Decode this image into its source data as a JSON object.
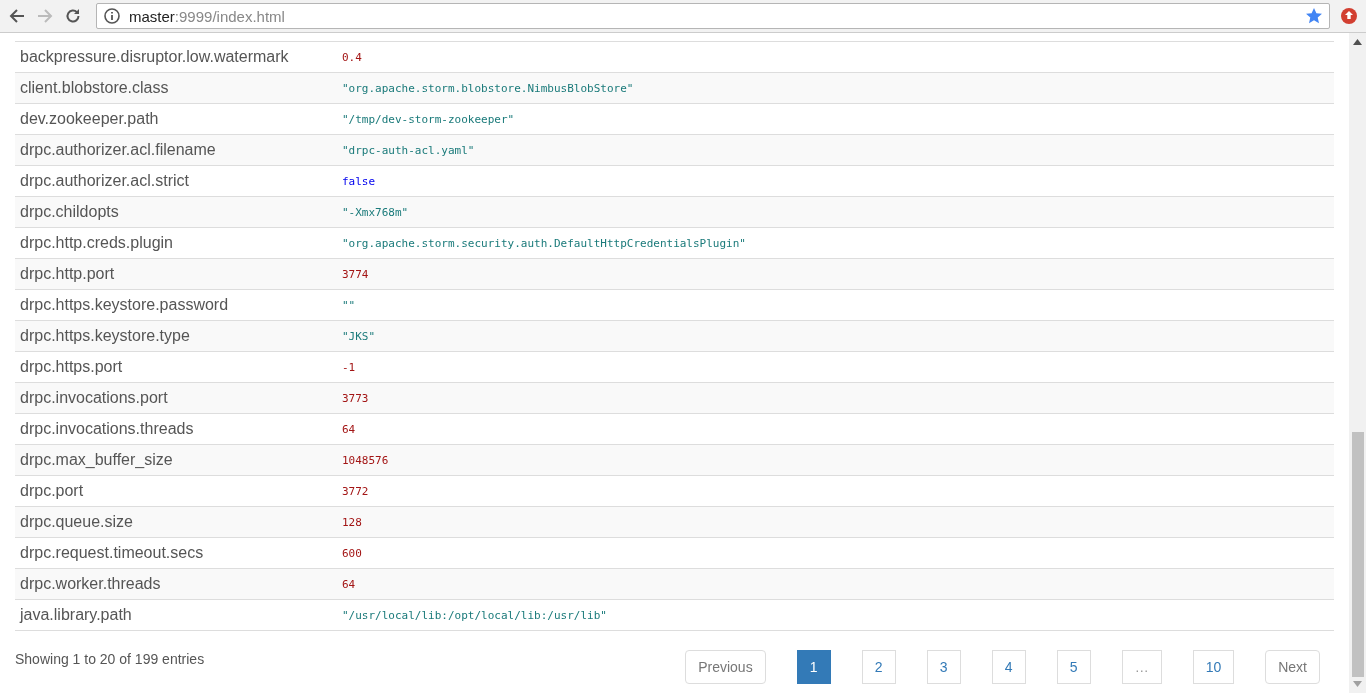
{
  "browser": {
    "url_host": "master",
    "url_path": ":9999/index.html"
  },
  "table": {
    "rows": [
      {
        "key": "backpressure.disruptor.low.watermark",
        "value": "0.4",
        "kind": "number"
      },
      {
        "key": "client.blobstore.class",
        "value": "\"org.apache.storm.blobstore.NimbusBlobStore\"",
        "kind": "string"
      },
      {
        "key": "dev.zookeeper.path",
        "value": "\"/tmp/dev-storm-zookeeper\"",
        "kind": "string"
      },
      {
        "key": "drpc.authorizer.acl.filename",
        "value": "\"drpc-auth-acl.yaml\"",
        "kind": "string"
      },
      {
        "key": "drpc.authorizer.acl.strict",
        "value": "false",
        "kind": "boolean"
      },
      {
        "key": "drpc.childopts",
        "value": "\"-Xmx768m\"",
        "kind": "string"
      },
      {
        "key": "drpc.http.creds.plugin",
        "value": "\"org.apache.storm.security.auth.DefaultHttpCredentialsPlugin\"",
        "kind": "string"
      },
      {
        "key": "drpc.http.port",
        "value": "3774",
        "kind": "number"
      },
      {
        "key": "drpc.https.keystore.password",
        "value": "\"\"",
        "kind": "string"
      },
      {
        "key": "drpc.https.keystore.type",
        "value": "\"JKS\"",
        "kind": "string"
      },
      {
        "key": "drpc.https.port",
        "value": "-1",
        "kind": "number"
      },
      {
        "key": "drpc.invocations.port",
        "value": "3773",
        "kind": "number"
      },
      {
        "key": "drpc.invocations.threads",
        "value": "64",
        "kind": "number"
      },
      {
        "key": "drpc.max_buffer_size",
        "value": "1048576",
        "kind": "number"
      },
      {
        "key": "drpc.port",
        "value": "3772",
        "kind": "number"
      },
      {
        "key": "drpc.queue.size",
        "value": "128",
        "kind": "number"
      },
      {
        "key": "drpc.request.timeout.secs",
        "value": "600",
        "kind": "number"
      },
      {
        "key": "drpc.worker.threads",
        "value": "64",
        "kind": "number"
      },
      {
        "key": "java.library.path",
        "value": "\"/usr/local/lib:/opt/local/lib:/usr/lib\"",
        "kind": "string"
      }
    ]
  },
  "footer": {
    "info": "Showing 1 to 20 of 199 entries",
    "pagination": [
      {
        "label": "Previous",
        "kind": "nav",
        "selected": false
      },
      {
        "label": "1",
        "kind": "page",
        "selected": true
      },
      {
        "label": "2",
        "kind": "page",
        "selected": false
      },
      {
        "label": "3",
        "kind": "page",
        "selected": false
      },
      {
        "label": "4",
        "kind": "page",
        "selected": false
      },
      {
        "label": "5",
        "kind": "page",
        "selected": false
      },
      {
        "label": "…",
        "kind": "ellipsis",
        "selected": false
      },
      {
        "label": "10",
        "kind": "page",
        "selected": false
      },
      {
        "label": "Next",
        "kind": "nav",
        "selected": false
      }
    ]
  }
}
